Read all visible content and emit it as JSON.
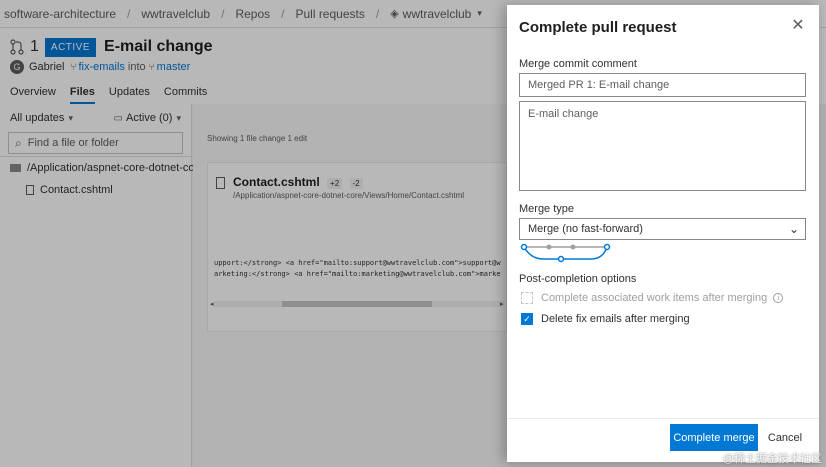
{
  "breadcrumb": {
    "items": [
      "software-architecture",
      "wwtravelclub",
      "Repos",
      "Pull requests"
    ],
    "repo": "wwtravelclub"
  },
  "pr": {
    "number": "1",
    "status": "ACTIVE",
    "title": "E-mail change",
    "author_initial": "G",
    "author": "Gabriel",
    "source_branch": "fix-emails",
    "into": "into",
    "target_branch": "master"
  },
  "tabs": [
    "Overview",
    "Files",
    "Updates",
    "Commits"
  ],
  "active_tab": "Files",
  "files_pane": {
    "filter": "All updates",
    "active_filter": "Active (0)",
    "search_placeholder": "Find a file or folder",
    "folder": "/Application/aspnet-core-dotnet-core/...",
    "file": "Contact.cshtml"
  },
  "content": {
    "changes_info": "Showing 1 file change   1 edit",
    "file_name": "Contact.cshtml",
    "additions": "+2",
    "deletions": "-2",
    "file_path": "/Application/aspnet-core-dotnet-core/Views/Home/Contact.cshtml",
    "code_line_1": "upport:</strong> <a href=\"mailto:support@wwtravelclub.com\">support@w",
    "code_line_2": "arketing:</strong> <a href=\"mailto:marketing@wwtravelclub.com\">marke"
  },
  "panel": {
    "title": "Complete pull request",
    "merge_commit_label": "Merge commit comment",
    "merge_commit_value": "Merged PR 1: E-mail change",
    "description_value": "E-mail change",
    "merge_type_label": "Merge type",
    "merge_type_value": "Merge (no fast-forward)",
    "post_completion_label": "Post-completion options",
    "option_1": "Complete associated work items after merging",
    "option_2": "Delete fix emails after merging",
    "complete_button": "Complete merge",
    "cancel_button": "Cancel"
  },
  "watermark": "@稀土掘金技术社区",
  "colors": {
    "accent": "#0078d4",
    "text": "#323130",
    "muted": "#605e5c"
  }
}
